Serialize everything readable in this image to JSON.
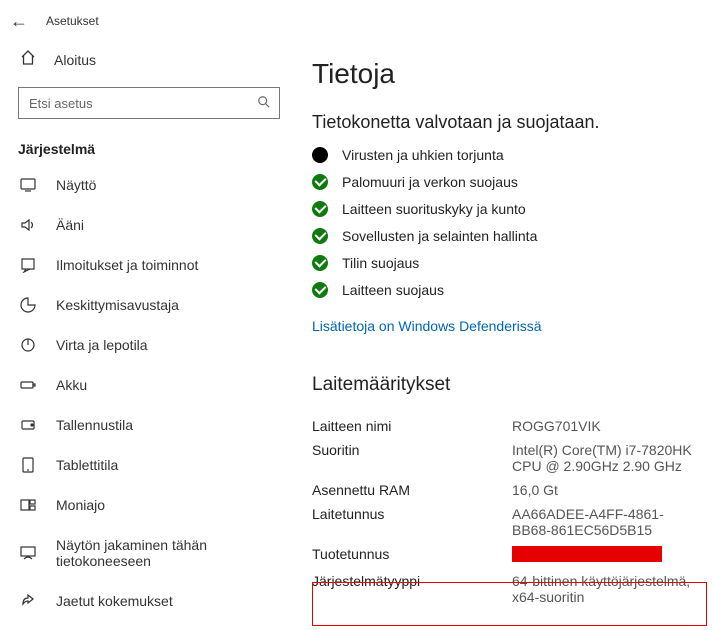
{
  "app_title": "Asetukset",
  "home_label": "Aloitus",
  "search_placeholder": "Etsi asetus",
  "section_title": "Järjestelmä",
  "nav": [
    {
      "label": "Näyttö"
    },
    {
      "label": "Ääni"
    },
    {
      "label": "Ilmoitukset ja toiminnot"
    },
    {
      "label": "Keskittymisavustaja"
    },
    {
      "label": "Virta ja lepotila"
    },
    {
      "label": "Akku"
    },
    {
      "label": "Tallennustila"
    },
    {
      "label": "Tablettitila"
    },
    {
      "label": "Moniajo"
    },
    {
      "label": "Näytön jakaminen tähän tietokoneeseen"
    },
    {
      "label": "Jaetut kokemukset"
    }
  ],
  "page_title": "Tietoja",
  "sub_title": "Tietokonetta valvotaan ja suojataan.",
  "status": [
    {
      "label": "Virusten ja uhkien torjunta",
      "state": "warn"
    },
    {
      "label": "Palomuuri ja verkon suojaus",
      "state": "ok"
    },
    {
      "label": "Laitteen suorituskyky ja kunto",
      "state": "ok"
    },
    {
      "label": "Sovellusten ja selainten hallinta",
      "state": "ok"
    },
    {
      "label": "Tilin suojaus",
      "state": "ok"
    },
    {
      "label": "Laitteen suojaus",
      "state": "ok"
    }
  ],
  "defender_link": "Lisätietoja on Windows Defenderissä",
  "specs_title": "Laitemääritykset",
  "specs": {
    "device_name_label": "Laitteen nimi",
    "device_name": "ROGG701VIK",
    "processor_label": "Suoritin",
    "processor": "Intel(R) Core(TM) i7-7820HK CPU @ 2.90GHz   2.90 GHz",
    "ram_label": "Asennettu RAM",
    "ram": "16,0 Gt",
    "device_id_label": "Laitetunnus",
    "device_id": "AA66ADEE-A4FF-4861-BB68-861EC56D5B15",
    "product_id_label": "Tuotetunnus",
    "system_type_label": "Järjestelmätyyppi",
    "system_type": "64-bittinen käyttöjärjestelmä, x64-suoritin"
  }
}
